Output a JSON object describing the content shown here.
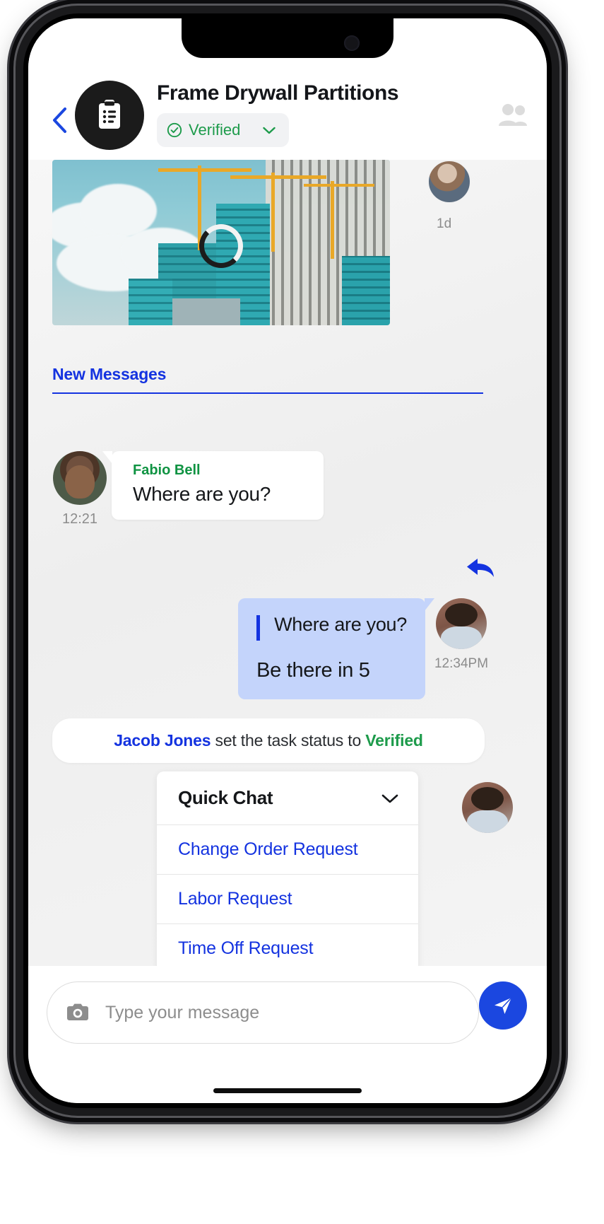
{
  "header": {
    "back_icon": "chevron-left-icon",
    "task_icon": "clipboard-icon",
    "title": "Frame Drywall Partitions",
    "status_label": "Verified",
    "status_check_icon": "check-circle-icon",
    "status_chevron_icon": "chevron-down-icon",
    "members_icon": "people-icon"
  },
  "chat": {
    "photo_message": {
      "type": "image",
      "loading_icon": "spinner-icon",
      "time": "1d",
      "avatar": "avatar-jacob"
    },
    "divider": {
      "label": "New Messages"
    },
    "incoming": {
      "avatar": "avatar-fabio",
      "time": "12:21",
      "sender": "Fabio Bell",
      "text": "Where are you?"
    },
    "reply_icon": "reply-arrow-icon",
    "outgoing": {
      "quoted_text": "Where are you?",
      "text": "Be there in 5",
      "avatar": "avatar-jacob",
      "time": "12:34PM"
    },
    "status_event": {
      "actor": "Jacob Jones",
      "middle": " set the task status to ",
      "state": "Verified"
    },
    "quick_chat": {
      "title": "Quick Chat",
      "chevron_icon": "chevron-down-icon",
      "avatar": "avatar-jacob",
      "items": [
        {
          "label": "Change Order Request"
        },
        {
          "label": "Labor Request"
        },
        {
          "label": "Time Off Request"
        }
      ]
    }
  },
  "composer": {
    "camera_icon": "camera-icon",
    "input_value": "",
    "placeholder": "Type your message",
    "send_icon": "send-paper-plane-icon"
  },
  "colors": {
    "accent_blue": "#1433e0",
    "send_blue": "#1b47e0",
    "verified_green": "#1d9b4b",
    "sender_green": "#0f9342",
    "outgoing_bubble": "#c4d4fb",
    "chat_bg": "#f2f2f2"
  }
}
